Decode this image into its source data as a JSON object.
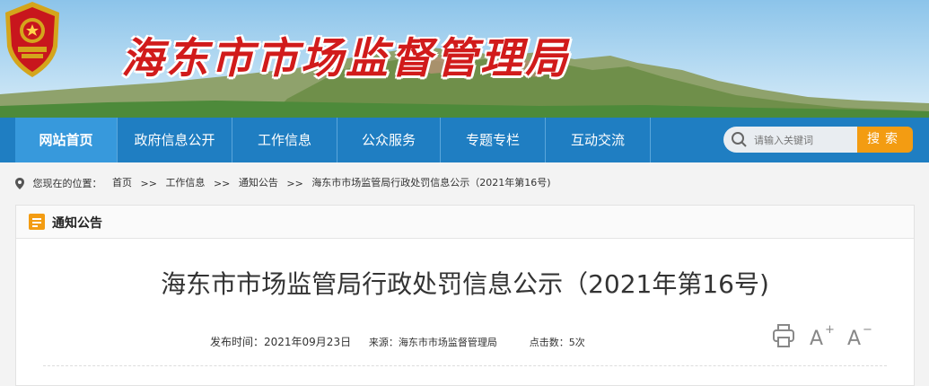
{
  "header": {
    "site_title": "海东市市场监督管理局",
    "emblem_icon": "national-emblem-icon"
  },
  "nav": {
    "items": [
      {
        "label": "网站首页",
        "active": true
      },
      {
        "label": "政府信息公开"
      },
      {
        "label": "工作信息"
      },
      {
        "label": "公众服务"
      },
      {
        "label": "专题专栏"
      },
      {
        "label": "互动交流"
      }
    ],
    "search_placeholder": "请输入关键词",
    "search_button": "搜索"
  },
  "breadcrumb": {
    "prefix": "您现在的位置：",
    "items": [
      "首页",
      "工作信息",
      "通知公告",
      "海东市市场监管局行政处罚信息公示（2021年第16号)"
    ],
    "separator": ">>"
  },
  "panel": {
    "title": "通知公告"
  },
  "article": {
    "title": "海东市市场监管局行政处罚信息公示（2021年第16号)",
    "publish_date": "发布时间：2021年09月23日",
    "source": "来源：海东市市场监督管理局",
    "clicks": "点击数：5次",
    "tools": [
      "print-icon",
      "font-increase-icon",
      "font-decrease-icon"
    ]
  },
  "colors": {
    "nav_bg": "#1f7ec2",
    "nav_active": "#3799dc",
    "search_button": "#f39c12",
    "title_red": "#d11b1b"
  }
}
